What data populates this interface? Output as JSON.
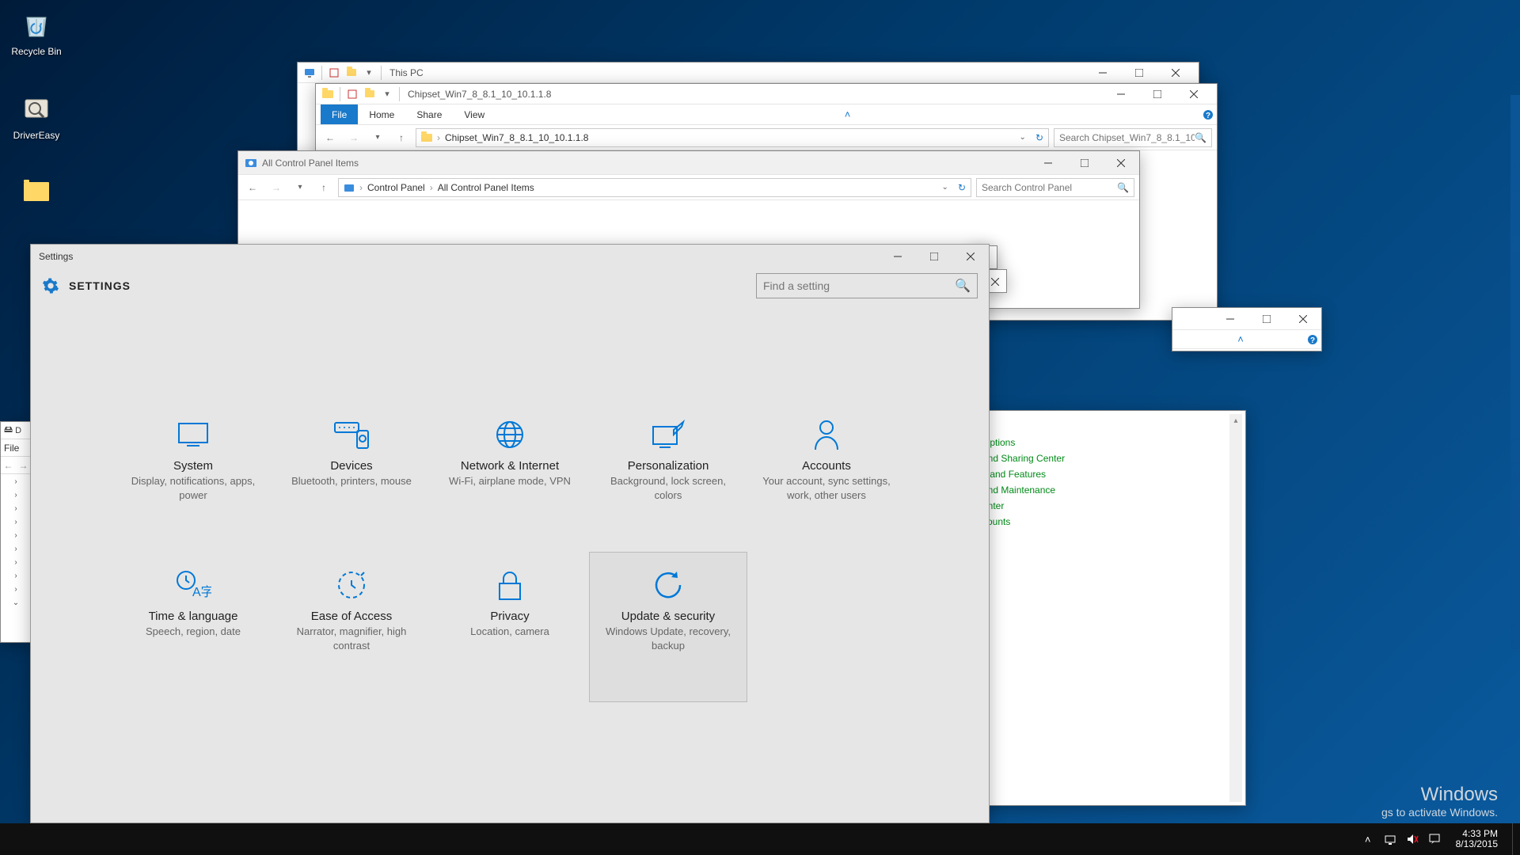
{
  "desktop": {
    "icons": [
      {
        "name": "Recycle Bin"
      },
      {
        "name": "DriverEasy"
      }
    ]
  },
  "explorer1": {
    "title": "This PC"
  },
  "explorer2": {
    "title": "Chipset_Win7_8_8.1_10_10.1.1.8",
    "tabs": {
      "file": "File",
      "home": "Home",
      "share": "Share",
      "view": "View"
    },
    "breadcrumb": "Chipset_Win7_8_8.1_10_10.1.1.8",
    "search_placeholder": "Search Chipset_Win7_8_8.1_10..."
  },
  "controlpanel": {
    "title": "All Control Panel Items",
    "crumbs": [
      "Control Panel",
      "All Control Panel Items"
    ],
    "search_placeholder": "Search Control Panel",
    "visible_links": [
      "Options",
      "and Sharing Center",
      "s and Features",
      "and Maintenance",
      "enter",
      "counts"
    ]
  },
  "explorer_back": {
    "file_tab": "File"
  },
  "settings": {
    "window_title": "Settings",
    "heading": "SETTINGS",
    "search_placeholder": "Find a setting",
    "tiles": [
      {
        "key": "system",
        "title": "System",
        "desc": "Display, notifications, apps, power"
      },
      {
        "key": "devices",
        "title": "Devices",
        "desc": "Bluetooth, printers, mouse"
      },
      {
        "key": "network",
        "title": "Network & Internet",
        "desc": "Wi-Fi, airplane mode, VPN"
      },
      {
        "key": "personalization",
        "title": "Personalization",
        "desc": "Background, lock screen, colors"
      },
      {
        "key": "accounts",
        "title": "Accounts",
        "desc": "Your account, sync settings, work, other users"
      },
      {
        "key": "time",
        "title": "Time & language",
        "desc": "Speech, region, date"
      },
      {
        "key": "ease",
        "title": "Ease of Access",
        "desc": "Narrator, magnifier, high contrast"
      },
      {
        "key": "privacy",
        "title": "Privacy",
        "desc": "Location, camera"
      },
      {
        "key": "update",
        "title": "Update & security",
        "desc": "Windows Update, recovery, backup"
      }
    ],
    "hovered": "update"
  },
  "watermark": {
    "line1": "Windows",
    "line2": "gs to activate Windows."
  },
  "taskbar": {
    "time": "4:33 PM",
    "date": "8/13/2015"
  }
}
